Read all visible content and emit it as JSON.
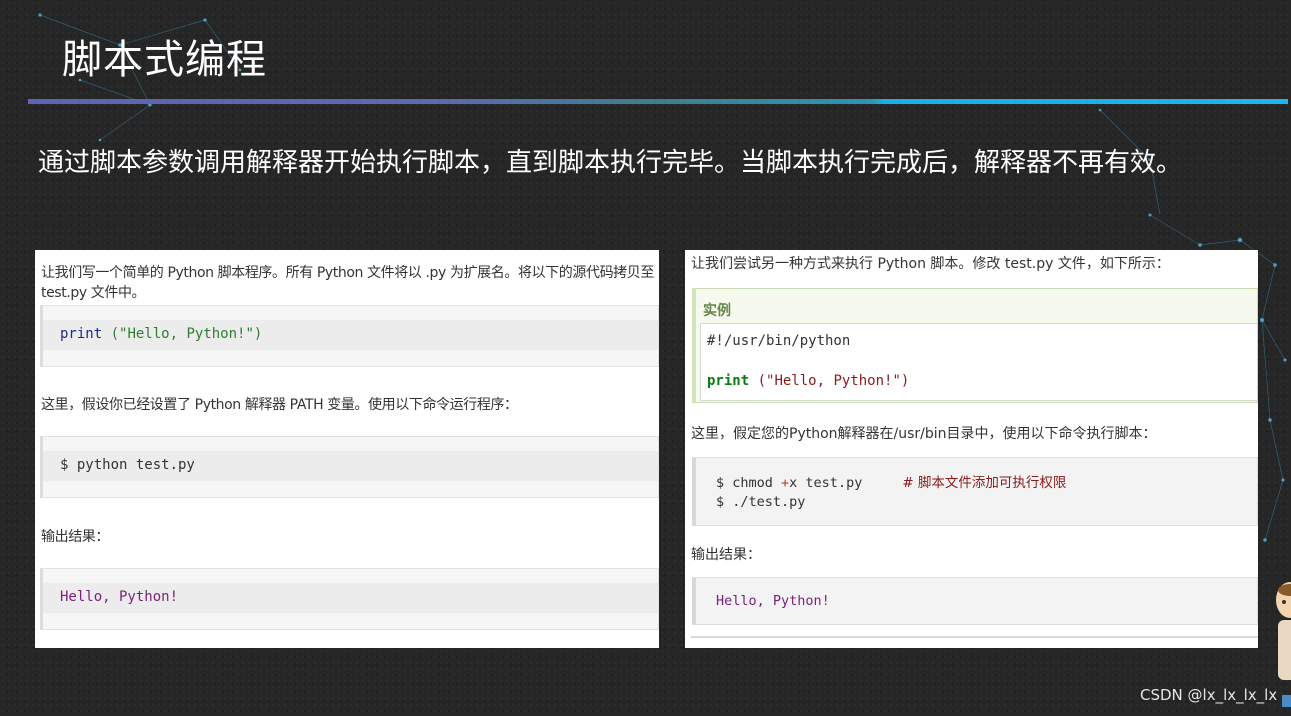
{
  "slide": {
    "title": "脚本式编程",
    "subtitle": "通过脚本参数调用解释器开始执行脚本，直到脚本执行完毕。当脚本执行完成后，解释器不再有效。"
  },
  "left_panel": {
    "intro": "让我们写一个简单的 Python 脚本程序。所有 Python 文件将以 .py 为扩展名。将以下的源代码拷贝至 test.py 文件中。",
    "code1": {
      "keyword": "print",
      "args": " (\"Hello, Python!\")"
    },
    "path_text": "这里，假设你已经设置了 Python 解释器 PATH 变量。使用以下命令运行程序：",
    "command": "$ python test.py",
    "output_label": "输出结果：",
    "output": "Hello, Python!"
  },
  "right_panel": {
    "intro": "让我们尝试另一种方式来执行 Python 脚本。修改 test.py 文件，如下所示：",
    "example_label": "实例",
    "shebang": "#!/usr/bin/python",
    "print_keyword": "print",
    "print_args": " (\"Hello, Python!\")",
    "interpreter_text": "这里，假定您的Python解释器在/usr/bin目录中，使用以下命令执行脚本：",
    "cmd1_prefix": "$ chmod ",
    "cmd1_op": "+",
    "cmd1_suffix": "x test.py",
    "cmd1_comment": "# 脚本文件添加可执行权限",
    "cmd2": "$ ./test.py",
    "output_label": "输出结果：",
    "output": "Hello, Python!"
  },
  "watermark": "CSDN @lx_lx_lx_lx",
  "colors": {
    "background": "#262626",
    "accent_bar_left": "#5f63b5",
    "accent_bar_right": "#1fb4ee",
    "keyword_blue": "#1a2a88",
    "string_green": "#2e7d32",
    "output_purple": "#7a1f7a",
    "right_keyword_green": "#0a7a14",
    "string_dark_red": "#8b1a1a",
    "example_label_green": "#64854c"
  }
}
